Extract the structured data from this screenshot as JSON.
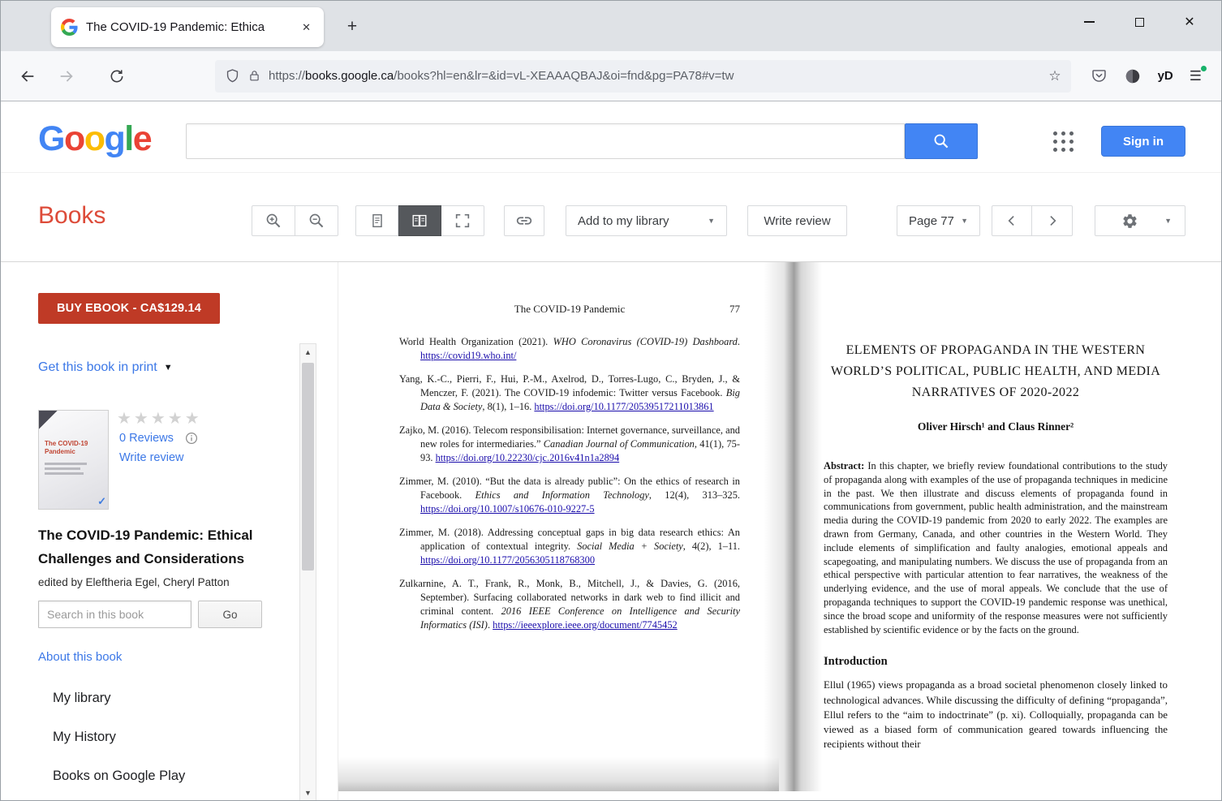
{
  "theme": {
    "accent_blue": "#4285F4",
    "books_red": "#DD4B39",
    "buy_button_red": "#BF3A26",
    "link_blue": "#3C78E7",
    "page_link_blue": "#1A0DAB",
    "selected_button_dark": "#55585C",
    "logo_colors": [
      "#4285F4",
      "#EA4335",
      "#FBBC05",
      "#4285F4",
      "#34A853",
      "#EA4335"
    ]
  },
  "icons": {
    "close_tab": "✕",
    "new_tab": "+",
    "close_window": "✕",
    "bookmark_star": "☆",
    "menu": "☰",
    "caret_down": "▼",
    "stars_rating": "★★★★★",
    "scroll_up": "▲",
    "scroll_down": "▼",
    "check": "✓"
  },
  "browser": {
    "tab_title": "The COVID-19 Pandemic: Ethica",
    "url_prefix": "https://",
    "url_domain": "books.google.ca",
    "url_path": "/books?hl=en&lr=&id=vL-XEAAAQBAJ&oi=fnd&pg=PA78#v=tw",
    "profile_label": "yD"
  },
  "header": {
    "logo_letters": [
      "G",
      "o",
      "o",
      "g",
      "l",
      "e"
    ],
    "sign_in_label": "Sign in"
  },
  "toolbar": {
    "books_label": "Books",
    "add_to_library_label": "Add to my library",
    "write_review_label": "Write review",
    "page_label": "Page 77"
  },
  "sidebar": {
    "buy_button_label": "BUY EBOOK - CA$129.14",
    "get_print_label": "Get this book in print",
    "cover_title": "The COVID-19 Pandemic",
    "reviews_label": "0 Reviews",
    "write_review_label": "Write review",
    "book_title": "The COVID-19 Pandemic: Ethical Challenges and Considerations",
    "edited_by": "edited by Eleftheria Egel, Cheryl Patton",
    "search_placeholder": "Search in this book",
    "go_label": "Go",
    "about_label": "About this book",
    "nav_items": [
      "My library",
      "My History",
      "Books on Google Play"
    ]
  },
  "left_page": {
    "running_title": "The COVID-19 Pandemic",
    "page_number": "77",
    "references": [
      {
        "before": "World Health Organization (2021). ",
        "italic": "WHO Coronavirus (COVID-19) Dashboard",
        "after": ". ",
        "url": "https://covid19.who.int/"
      },
      {
        "before": "Yang, K.-C., Pierri, F., Hui, P.-M., Axelrod, D., Torres-Lugo, C., Bryden, J., & Menczer, F. (2021). The COVID-19 infodemic: Twitter versus Facebook. ",
        "italic": "Big Data & Society",
        "after": ", 8(1), 1–16. ",
        "url": "https://doi.org/10.1177/20539517211013861"
      },
      {
        "before": "Zajko, M. (2016). Telecom responsibilisation: Internet governance, surveillance, and new roles for intermediaries.” ",
        "italic": "Canadian Journal of Communication",
        "after": ", 41(1), 75-93. ",
        "url": "https://doi.org/10.22230/cjc.2016v41n1a2894"
      },
      {
        "before": "Zimmer, M. (2010). “But the data is already public”: On the ethics of research in Facebook. ",
        "italic": "Ethics and Information Technology",
        "after": ", 12(4), 313–325. ",
        "url": "https://doi.org/10.1007/s10676-010-9227-5"
      },
      {
        "before": "Zimmer, M. (2018). Addressing conceptual gaps in big data research ethics: An application of contextual integrity. ",
        "italic": "Social Media + Society",
        "after": ", 4(2), 1–11. ",
        "url": "https://doi.org/10.1177/2056305118768300"
      },
      {
        "before": "Zulkarnine, A. T., Frank, R., Monk, B., Mitchell, J., & Davies, G. (2016, September). Surfacing collaborated networks in dark web to find illicit and criminal content. ",
        "italic": "2016 IEEE Conference on Intelligence and Security Informatics (ISI)",
        "after": ". ",
        "url": "https://ieeexplore.ieee.org/document/7745452"
      }
    ]
  },
  "right_page": {
    "title": "ELEMENTS OF PROPAGANDA IN THE WESTERN WORLD’S POLITICAL, PUBLIC HEALTH, AND MEDIA NARRATIVES OF 2020-2022",
    "authors": "Oliver Hirsch¹ and Claus Rinner²",
    "abstract_label": "Abstract:",
    "abstract_text": " In this chapter, we briefly review foundational contributions to the study of propaganda along with examples of the use of propaganda techniques in medicine in the past. We then illustrate and discuss elements of propaganda found in communications from government, public health administration, and the mainstream media during the COVID-19 pandemic from 2020 to early 2022. The examples are drawn from Germany, Canada, and other countries in the Western World. They include elements of simplification and faulty analogies, emotional appeals and scapegoating, and manipulating numbers. We discuss the use of propaganda from an ethical perspective with particular attention to fear narratives, the weakness of the underlying evidence, and the use of moral appeals. We conclude that the use of propaganda techniques to support the COVID-19 pandemic response was unethical, since the broad scope and uniformity of the response measures were not sufficiently established by scientific evidence or by the facts on the ground.",
    "intro_heading": "Introduction",
    "intro_text": "Ellul (1965) views propaganda as a broad societal phenomenon closely linked to technological advances. While discussing the difficulty of defining “propaganda”, Ellul refers to the “aim to indoctrinate” (p. xi). Colloquially, propaganda can be viewed as a biased form of communication geared towards influencing the recipients without their"
  }
}
